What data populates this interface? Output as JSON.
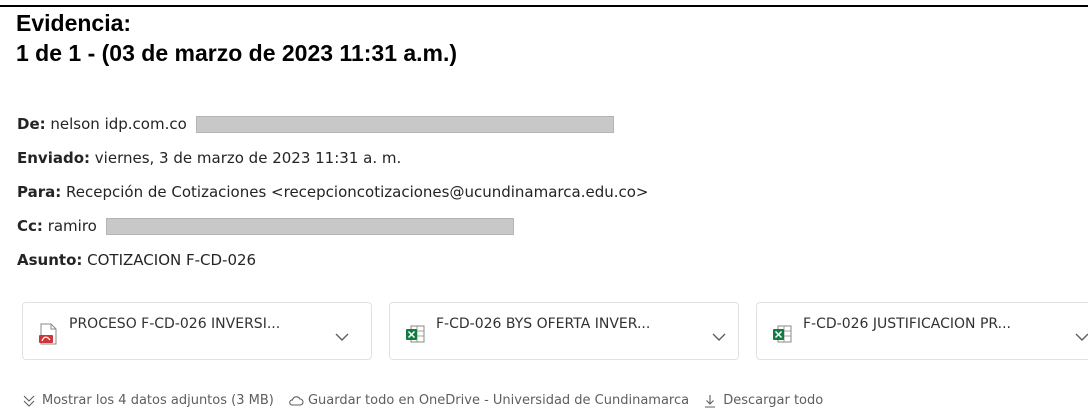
{
  "evidence": {
    "heading": "Evidencia:",
    "subheading": "1 de 1 - (03 de marzo de 2023 11:31 a.m.)"
  },
  "email": {
    "from_label": "De:",
    "from_value": "nelson idp.com.co",
    "sent_label": "Enviado:",
    "sent_value": "viernes, 3 de marzo de 2023 11:31 a. m.",
    "to_label": "Para:",
    "to_value": "Recepción de Cotizaciones <recepcioncotizaciones@ucundinamarca.edu.co>",
    "cc_label": "Cc:",
    "cc_value": "ramiro",
    "subject_label": "Asunto:",
    "subject_value": "COTIZACION F-CD-026"
  },
  "attachments": [
    {
      "name": "PROCESO F-CD-026 INVERSI...",
      "type": "pdf-icon"
    },
    {
      "name": "F-CD-026 BYS OFERTA INVER...",
      "type": "excel-icon"
    },
    {
      "name": "F-CD-026 JUSTIFICACION PR...",
      "type": "excel-icon"
    }
  ],
  "actions": {
    "show_all": "Mostrar los 4 datos adjuntos (3 MB)",
    "save_onedrive": "Guardar todo en OneDrive - Universidad de Cundinamarca",
    "download_all": "Descargar todo"
  },
  "colors": {
    "pdf": "#d13438",
    "excel": "#107c41",
    "redaction": "#c8c8c8",
    "text": "#242424",
    "muted": "#605e5c"
  }
}
